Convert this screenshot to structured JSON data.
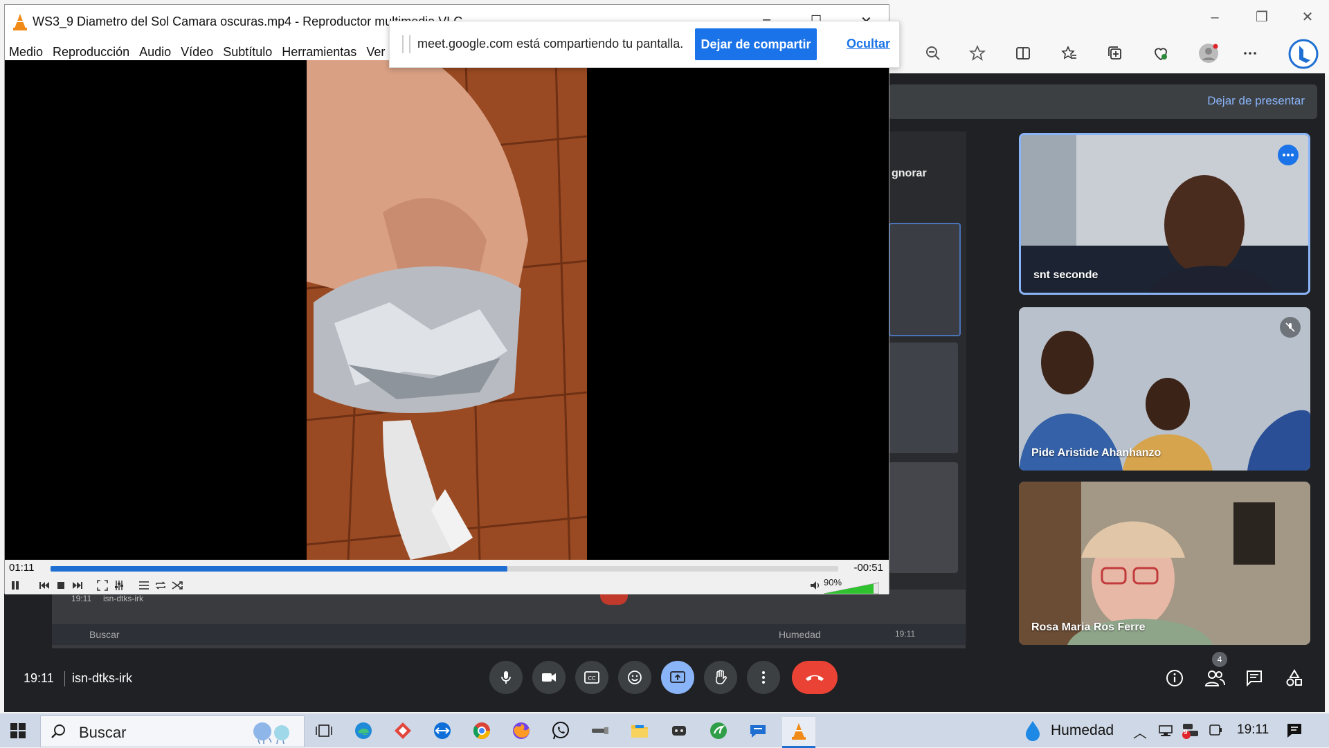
{
  "vlc": {
    "title": "WS3_9 Diametro del Sol Camara oscuras.mp4 - Reproductor multimedia VLC",
    "menu": [
      "Medio",
      "Reproducción",
      "Audio",
      "Vídeo",
      "Subtítulo",
      "Herramientas",
      "Ver"
    ],
    "elapsed": "01:11",
    "remaining": "-00:51",
    "progress_fraction": 0.58,
    "volume_label": "90%",
    "volume_fraction": 0.9
  },
  "share_notice": {
    "text": "meet.google.com está compartiendo tu pantalla.",
    "stop_label": "Dejar de compartir",
    "hide_label": "Ocultar"
  },
  "meet": {
    "stop_presenting": "Dejar de presentar",
    "clock": "19:11",
    "meeting_code": "isn-dtks-irk",
    "people_count": "4",
    "nested_fragment": "gnorar",
    "participants": [
      {
        "name": "snt seconde"
      },
      {
        "name": "Pide Aristide Ahanhanzo"
      },
      {
        "name": "Rosa Maria Ros Ferre"
      }
    ],
    "nested_taskbar": {
      "search": "Buscar",
      "weather": "Humedad",
      "clock": "19:11",
      "code": "isn-dtks-irk",
      "time": "19:11"
    }
  },
  "taskbar": {
    "search_placeholder": "Buscar",
    "weather": "Humedad",
    "clock": "19:11",
    "notification_badge": "9"
  },
  "colors": {
    "meet_bg": "#202124",
    "accent_blue": "#1a73e8",
    "hangup_red": "#ea4335",
    "present_blue": "#8ab4f8"
  }
}
